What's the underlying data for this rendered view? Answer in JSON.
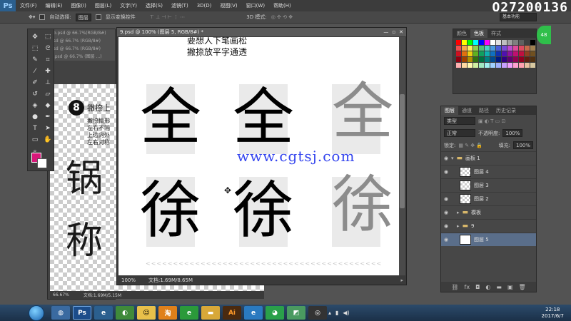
{
  "menubar": {
    "logo": "Ps",
    "items": [
      "文件(F)",
      "编辑(E)",
      "图像(I)",
      "图层(L)",
      "文字(Y)",
      "选择(S)",
      "滤镜(T)",
      "3D(D)",
      "视图(V)",
      "窗口(W)",
      "帮助(H)"
    ],
    "watermark": "Q27200136"
  },
  "options": {
    "auto_select_label": "自动选择:",
    "auto_select_value": "图层",
    "transform_label": "显示变换控件",
    "mode_3d": "3D 模式:"
  },
  "back_doc": {
    "tabs": [
      "6b.psd @ 66.7%(RGB/8#)",
      "psd @ 66.7% (RGB/8#)",
      "psd @ 66.7% (RGB/8#)",
      "8.psd @ 66.7% (图层 ...)"
    ],
    "step_number": "8",
    "step_title": "撇捺上",
    "step_lines": [
      "撇捺搞形",
      "左右不同",
      "上边向外",
      "左右对称"
    ],
    "glyph_top": "锅",
    "glyph_bottom": "称",
    "zoom": "66.67%",
    "doc_info": "文档:1.69M/5.15M"
  },
  "main_doc": {
    "tab_title": "9.psd @ 100% (图层 5, RGB/8#) *",
    "note_line_1": "要想人下笔画松",
    "note_line_2": "撇捺放平字通透",
    "glyph_row_1": [
      "全",
      "全",
      "全"
    ],
    "glyph_row_2": [
      "徐",
      "徐",
      "徐"
    ],
    "watermark_url": "www.cgtsj.com",
    "chevrons": "<<<<<<<<<<<<<<<<<<<<<<<<<<<<<<<<<<<<<<<<<<<<<<<<<<<<<<<<<<<<",
    "zoom": "100%",
    "doc_info": "文档:1.69M/8.65M"
  },
  "color_panel": {
    "tabs": [
      "颜色",
      "色板",
      "样式"
    ],
    "active_tab": "色板",
    "extra_tab": "基本功能",
    "swatches": [
      "#ff0000",
      "#ffff00",
      "#00ff00",
      "#00ffff",
      "#0000ff",
      "#ff00ff",
      "#ffffff",
      "#e0e0e0",
      "#c0c0c0",
      "#a0a0a0",
      "#808080",
      "#606060",
      "#404040",
      "#000000",
      "#f04e4e",
      "#f7a84a",
      "#fff25a",
      "#8fd24a",
      "#4ac27a",
      "#4ad0c8",
      "#4a9ae0",
      "#4a5ed8",
      "#7a4ad8",
      "#c04ad0",
      "#e04a9a",
      "#e04a60",
      "#c86a4a",
      "#a08050",
      "#d01020",
      "#e07010",
      "#f0d010",
      "#60b020",
      "#10a060",
      "#10b0b0",
      "#1070c0",
      "#1030b0",
      "#5010b0",
      "#9010a0",
      "#c01070",
      "#c01040",
      "#904020",
      "#705020",
      "#900010",
      "#a04000",
      "#b09000",
      "#307010",
      "#007040",
      "#008080",
      "#004a90",
      "#001a80",
      "#300080",
      "#600070",
      "#900050",
      "#900020",
      "#602010",
      "#503010",
      "#ffb0b0",
      "#ffd8a0",
      "#fff8b0",
      "#d0f0a0",
      "#a0e8c0",
      "#a0f0f0",
      "#a0d0ff",
      "#a0b0ff",
      "#c8a0ff",
      "#f0a0ff",
      "#ffa0d0",
      "#ffa0b0",
      "#e8c0a0",
      "#d8c8a0"
    ]
  },
  "layer_panel": {
    "tabs": [
      "图层",
      "通道",
      "路径",
      "历史记录"
    ],
    "kind_label": "类型",
    "blend_mode": "正常",
    "opacity_label": "不透明度:",
    "opacity_value": "100%",
    "lock_label": "锁定:",
    "fill_label": "填充:",
    "fill_value": "100%",
    "layers": [
      {
        "name": "画板 1",
        "type": "group-open",
        "selected": false
      },
      {
        "name": "图层 4",
        "type": "layer",
        "selected": false
      },
      {
        "name": "图层 3",
        "type": "layer",
        "selected": false
      },
      {
        "name": "图层 2",
        "type": "layer",
        "selected": false
      },
      {
        "name": "模板",
        "type": "group",
        "selected": false
      },
      {
        "name": "9",
        "type": "group",
        "selected": false
      },
      {
        "name": "图层 5",
        "type": "layer",
        "selected": true
      }
    ]
  },
  "taskbar": {
    "time": "22:18",
    "date": "2017/6/7"
  }
}
